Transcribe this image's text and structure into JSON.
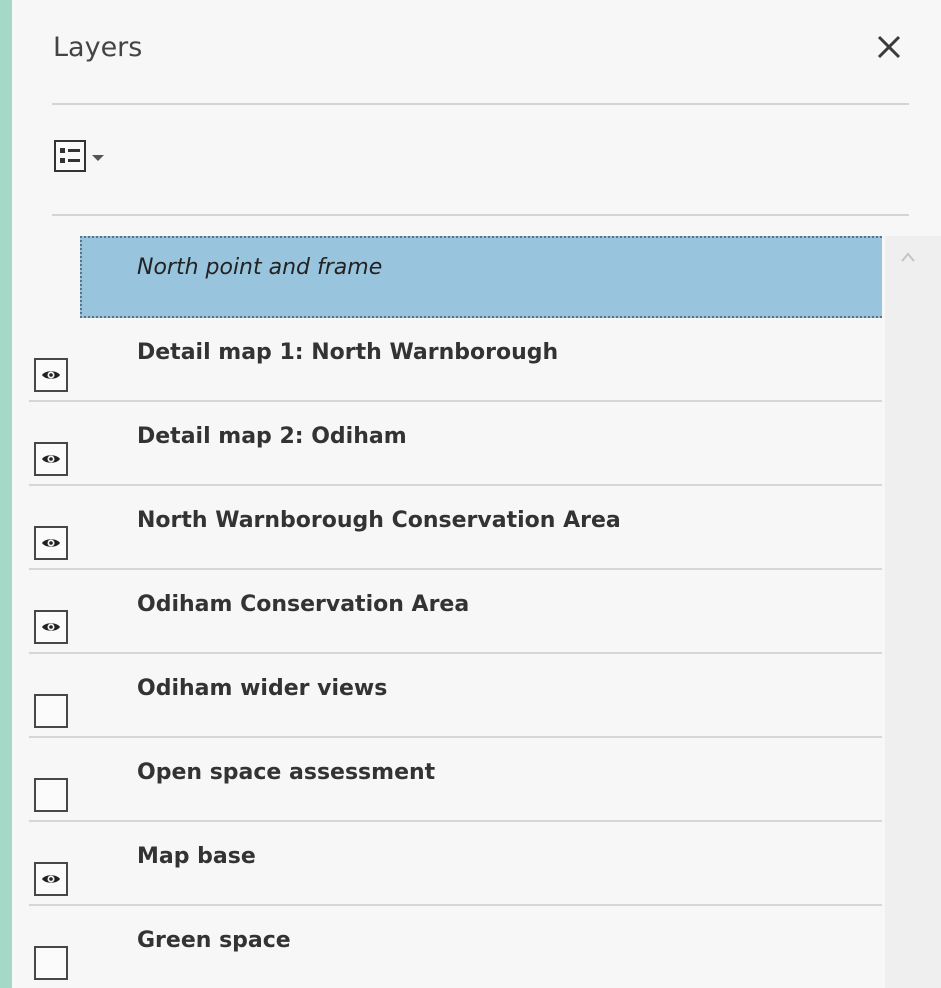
{
  "panel": {
    "title": "Layers",
    "close_icon": "close-icon",
    "options_icon": "layer-options-icon",
    "options_dropdown_icon": "chevron-down-icon"
  },
  "layers": [
    {
      "label": "North point and frame",
      "visible": null,
      "selected": true
    },
    {
      "label": "Detail map 1: North Warnborough",
      "visible": true
    },
    {
      "label": "Detail map 2: Odiham",
      "visible": true
    },
    {
      "label": "North Warnborough Conservation Area",
      "visible": true
    },
    {
      "label": "Odiham Conservation Area",
      "visible": true
    },
    {
      "label": "Odiham wider views",
      "visible": false
    },
    {
      "label": "Open space assessment",
      "visible": false
    },
    {
      "label": "Map base",
      "visible": true
    },
    {
      "label": "Green space",
      "visible": false
    }
  ],
  "colors": {
    "background": "#a6d8c8",
    "panel": "#f7f7f7",
    "selection": "#99c4de"
  }
}
